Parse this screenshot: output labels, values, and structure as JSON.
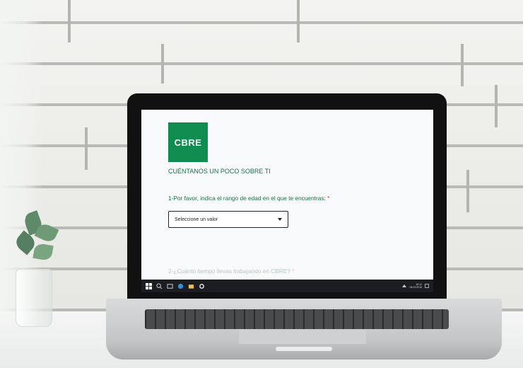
{
  "form": {
    "logo_text": "CBRE",
    "section_title": "CUÉNTANOS UN POCO SOBRE TI",
    "question1": "1-Por favor, indica el rango de edad en el que te encuentras:",
    "question1_required": "*",
    "select_value": "Seleccione un valor",
    "question2": "2-¿Cuánto tiempo llevas trabajando en CBRE?",
    "question2_required": "*"
  },
  "taskbar": {
    "time": "18:12",
    "date": "06/12/2018",
    "icons": [
      "windows-icon",
      "search-icon",
      "task-view-icon",
      "edge-icon",
      "file-explorer-icon",
      "settings-icon"
    ]
  },
  "colors": {
    "brand_green": "#0f8c4f",
    "text_green": "#1b6f45",
    "required_red": "#e02a2a"
  }
}
